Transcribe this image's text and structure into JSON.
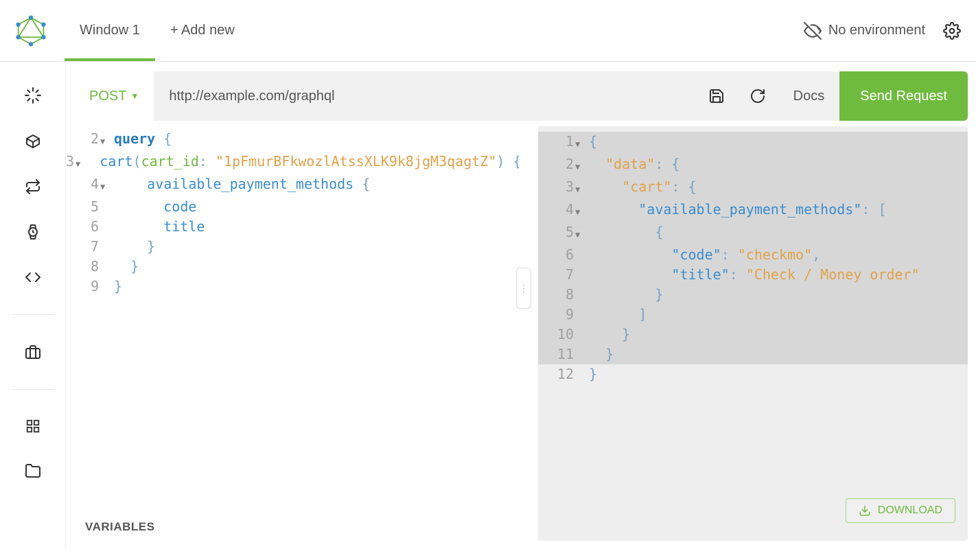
{
  "header": {
    "tabs": [
      {
        "label": "Window 1",
        "active": true
      },
      {
        "label": "+ Add new",
        "active": false
      }
    ],
    "environment_label": "No environment"
  },
  "request_bar": {
    "method": "POST",
    "url": "http://example.com/graphql",
    "docs_label": "Docs",
    "send_label": "Send Request"
  },
  "query": {
    "lines": [
      {
        "n": "2",
        "fold": "▼",
        "frags": [
          {
            "t": "query ",
            "cls": "tok-keyword"
          },
          {
            "t": "{",
            "cls": "tok-brace"
          }
        ]
      },
      {
        "n": "3",
        "fold": "▼",
        "frags": [
          {
            "t": "  ",
            "cls": ""
          },
          {
            "t": "cart",
            "cls": "tok-field"
          },
          {
            "t": "(",
            "cls": "tok-brace"
          },
          {
            "t": "cart_id",
            "cls": "tok-arg"
          },
          {
            "t": ": ",
            "cls": "tok-brace"
          },
          {
            "t": "\"1pFmurBFkwozlAtssXLK9k8jgM3qagtZ\"",
            "cls": "tok-string"
          },
          {
            "t": ") {",
            "cls": "tok-brace"
          }
        ]
      },
      {
        "n": "4",
        "fold": "▼",
        "frags": [
          {
            "t": "    ",
            "cls": ""
          },
          {
            "t": "available_payment_methods",
            "cls": "tok-field"
          },
          {
            "t": " {",
            "cls": "tok-brace"
          }
        ]
      },
      {
        "n": "5",
        "fold": "",
        "frags": [
          {
            "t": "      ",
            "cls": ""
          },
          {
            "t": "code",
            "cls": "tok-field"
          }
        ]
      },
      {
        "n": "6",
        "fold": "",
        "frags": [
          {
            "t": "      ",
            "cls": ""
          },
          {
            "t": "title",
            "cls": "tok-field"
          }
        ]
      },
      {
        "n": "7",
        "fold": "",
        "frags": [
          {
            "t": "    }",
            "cls": "tok-brace"
          }
        ]
      },
      {
        "n": "8",
        "fold": "",
        "frags": [
          {
            "t": "  }",
            "cls": "tok-brace"
          }
        ]
      },
      {
        "n": "9",
        "fold": "",
        "frags": [
          {
            "t": "}",
            "cls": "tok-brace"
          }
        ]
      }
    ]
  },
  "response": {
    "lines": [
      {
        "n": "1",
        "fold": "▼",
        "hl": true,
        "frags": [
          {
            "t": "{",
            "cls": "tok-brace"
          }
        ]
      },
      {
        "n": "2",
        "fold": "▼",
        "hl": true,
        "frags": [
          {
            "t": "  ",
            "cls": ""
          },
          {
            "t": "\"data\"",
            "cls": "tok-string"
          },
          {
            "t": ": {",
            "cls": "tok-brace"
          }
        ]
      },
      {
        "n": "3",
        "fold": "▼",
        "hl": true,
        "frags": [
          {
            "t": "    ",
            "cls": ""
          },
          {
            "t": "\"cart\"",
            "cls": "tok-string"
          },
          {
            "t": ": {",
            "cls": "tok-brace"
          }
        ]
      },
      {
        "n": "4",
        "fold": "▼",
        "hl": true,
        "frags": [
          {
            "t": "      ",
            "cls": ""
          },
          {
            "t": "\"available_payment_methods\"",
            "cls": "tok-key"
          },
          {
            "t": ": [",
            "cls": "tok-brace"
          }
        ]
      },
      {
        "n": "5",
        "fold": "▼",
        "hl": true,
        "frags": [
          {
            "t": "        {",
            "cls": "tok-brace"
          }
        ]
      },
      {
        "n": "6",
        "fold": "",
        "hl": true,
        "frags": [
          {
            "t": "          ",
            "cls": ""
          },
          {
            "t": "\"code\"",
            "cls": "tok-key"
          },
          {
            "t": ": ",
            "cls": "tok-brace"
          },
          {
            "t": "\"checkmo\"",
            "cls": "tok-string"
          },
          {
            "t": ",",
            "cls": "tok-brace"
          }
        ]
      },
      {
        "n": "7",
        "fold": "",
        "hl": true,
        "frags": [
          {
            "t": "          ",
            "cls": ""
          },
          {
            "t": "\"title\"",
            "cls": "tok-key"
          },
          {
            "t": ": ",
            "cls": "tok-brace"
          },
          {
            "t": "\"Check / Money order\"",
            "cls": "tok-string"
          }
        ]
      },
      {
        "n": "8",
        "fold": "",
        "hl": true,
        "frags": [
          {
            "t": "        }",
            "cls": "tok-brace"
          }
        ]
      },
      {
        "n": "9",
        "fold": "",
        "hl": true,
        "frags": [
          {
            "t": "      ]",
            "cls": "tok-brace"
          }
        ]
      },
      {
        "n": "10",
        "fold": "",
        "hl": true,
        "frags": [
          {
            "t": "    }",
            "cls": "tok-brace"
          }
        ]
      },
      {
        "n": "11",
        "fold": "",
        "hl": true,
        "frags": [
          {
            "t": "  }",
            "cls": "tok-brace"
          }
        ]
      },
      {
        "n": "12",
        "fold": "",
        "hl": false,
        "frags": [
          {
            "t": "}",
            "cls": "tok-brace"
          }
        ]
      }
    ]
  },
  "panels": {
    "variables_label": "VARIABLES",
    "download_label": "DOWNLOAD"
  }
}
